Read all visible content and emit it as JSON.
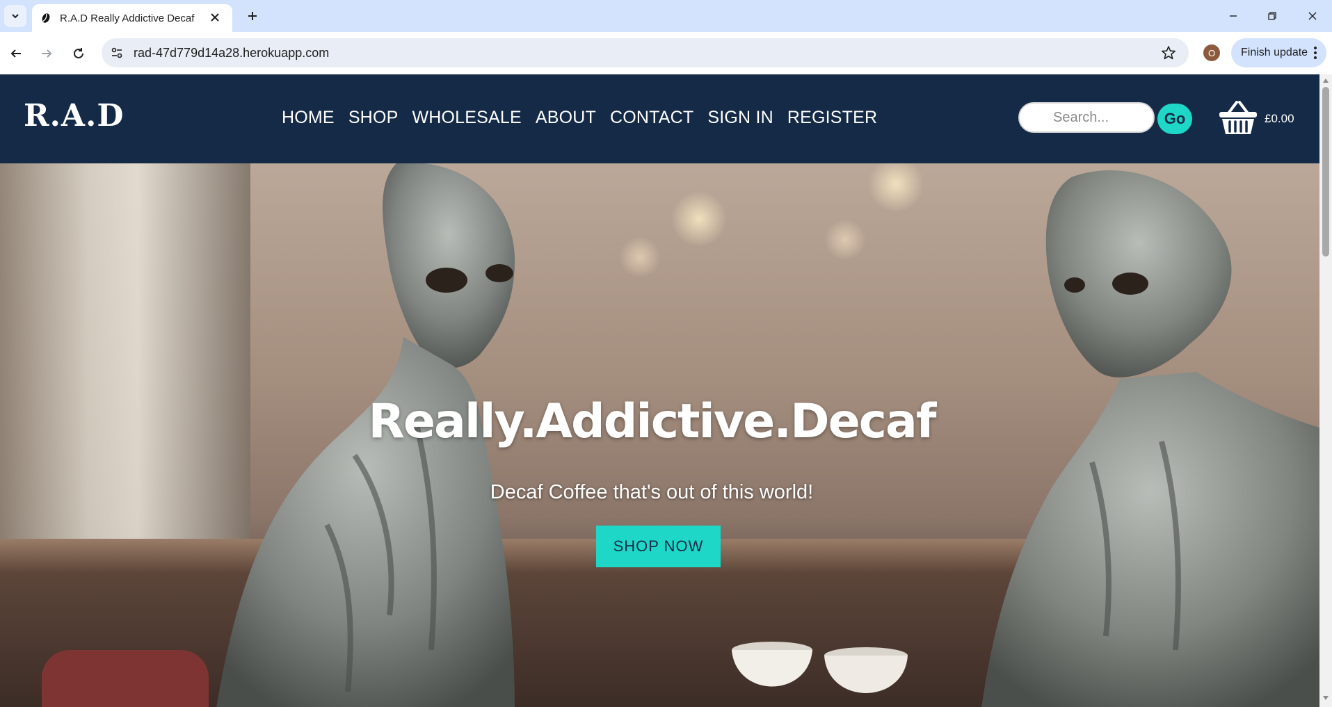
{
  "browser": {
    "tab_title": "R.A.D Really Addictive Decaf",
    "url": "rad-47d779d14a28.herokuapp.com",
    "profile_initial": "O",
    "update_label": "Finish update"
  },
  "site": {
    "logo": "R.A.D",
    "nav": [
      "HOME",
      "SHOP",
      "WHOLESALE",
      "ABOUT",
      "CONTACT",
      "SIGN IN",
      "REGISTER"
    ],
    "search_placeholder": "Search...",
    "go_label": "Go",
    "cart_total": "£0.00"
  },
  "hero": {
    "title": "Really.Addictive.Decaf",
    "subtitle": "Decaf Coffee that's out of this world!",
    "cta": "SHOP NOW"
  },
  "colors": {
    "navbar": "#142a46",
    "accent": "#1fd7c7",
    "chrome_tabstrip": "#d3e3fd"
  }
}
